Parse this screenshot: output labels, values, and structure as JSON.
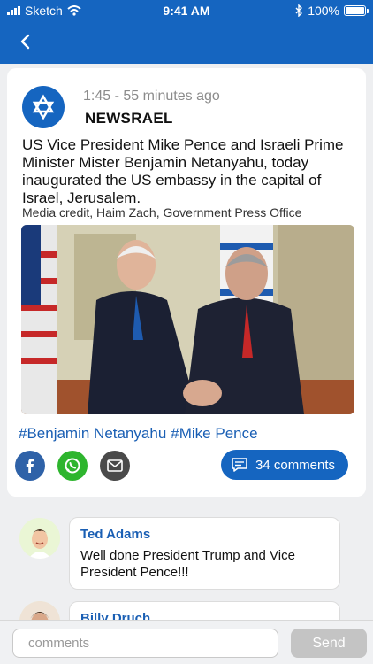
{
  "status_bar": {
    "carrier": "Sketch",
    "time": "9:41 AM",
    "battery": "100%"
  },
  "nav": {
    "back_icon": "chevron-left-icon"
  },
  "post": {
    "time": "1:45 - 55 minutes ago",
    "publisher": "NEWSRAEL",
    "text": "US Vice President Mike Pence and Israeli Prime Minister Mister Benjamin Netanyahu, today inaugurated the US embassy in the capital of Israel, Jerusalem.",
    "credit": "Media credit, Haim Zach, Government Press Office",
    "hashtags": [
      "#Benjamin Netanyahu",
      "#Mike Pence"
    ],
    "share_icons": [
      "facebook-icon",
      "whatsapp-icon",
      "mail-icon"
    ],
    "comments_label": "34 comments"
  },
  "comments": [
    {
      "author": "Ted Adams",
      "text": "Well done President Trump and Vice President Pence!!!"
    },
    {
      "author": "Billy Druch",
      "text": ""
    }
  ],
  "composer": {
    "placeholder": "comments",
    "send_label": "Send"
  },
  "colors": {
    "primary": "#1565c0",
    "link": "#1a5fb4",
    "facebook": "#2f62a8",
    "whatsapp": "#2eb52e"
  }
}
